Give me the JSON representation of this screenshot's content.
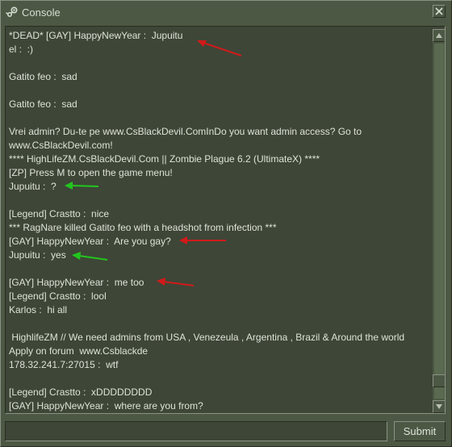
{
  "window": {
    "title": "Console",
    "close_icon": "close-x-icon",
    "app_icon": "steam-icon"
  },
  "log": {
    "lines": [
      "*DEAD* [GAY] HappyNewYear :  Jupuitu",
      "el :  :)",
      "",
      "Gatito feo :  sad",
      "",
      "Gatito feo :  sad",
      "",
      "Vrei admin? Du-te pe www.CsBlackDevil.ComInDo you want admin access? Go to www.CsBlackDevil.com!",
      "**** HighLifeZM.CsBlackDevil.Com || Zombie Plague 6.2 (UltimateX) ****",
      "[ZP] Press M to open the game menu!",
      "Jupuitu :  ?",
      "",
      "[Legend] Crastto :  nice",
      "*** RagNare killed Gatito feo with a headshot from infection ***",
      "[GAY] HappyNewYear :  Are you gay?",
      "Jupuitu :  yes",
      "",
      "[GAY] HappyNewYear :  me too",
      "[Legend] Crastto :  lool",
      "Karlos :  hi all",
      "",
      " HighlifeZM // We need admins from USA , Venezeula , Argentina , Brazil & Around the world  Apply on forum  www.Csblackde",
      "178.32.241.7:27015 :  wtf",
      "",
      "[Legend] Crastto :  xDDDDDDDD",
      "[GAY] HappyNewYear :  where are you from?"
    ]
  },
  "input": {
    "value": "",
    "placeholder": ""
  },
  "submit": {
    "label": "Submit"
  },
  "annotations": {
    "red_arrow_color": "#d11a1a",
    "green_arrow_color": "#22c51e"
  }
}
